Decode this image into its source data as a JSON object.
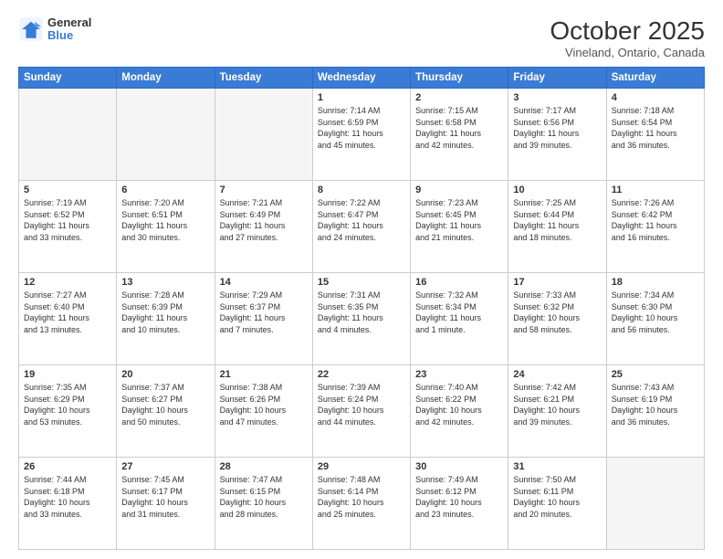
{
  "logo": {
    "general": "General",
    "blue": "Blue"
  },
  "title": "October 2025",
  "location": "Vineland, Ontario, Canada",
  "days_header": [
    "Sunday",
    "Monday",
    "Tuesday",
    "Wednesday",
    "Thursday",
    "Friday",
    "Saturday"
  ],
  "weeks": [
    [
      {
        "day": "",
        "info": ""
      },
      {
        "day": "",
        "info": ""
      },
      {
        "day": "",
        "info": ""
      },
      {
        "day": "1",
        "info": "Sunrise: 7:14 AM\nSunset: 6:59 PM\nDaylight: 11 hours\nand 45 minutes."
      },
      {
        "day": "2",
        "info": "Sunrise: 7:15 AM\nSunset: 6:58 PM\nDaylight: 11 hours\nand 42 minutes."
      },
      {
        "day": "3",
        "info": "Sunrise: 7:17 AM\nSunset: 6:56 PM\nDaylight: 11 hours\nand 39 minutes."
      },
      {
        "day": "4",
        "info": "Sunrise: 7:18 AM\nSunset: 6:54 PM\nDaylight: 11 hours\nand 36 minutes."
      }
    ],
    [
      {
        "day": "5",
        "info": "Sunrise: 7:19 AM\nSunset: 6:52 PM\nDaylight: 11 hours\nand 33 minutes."
      },
      {
        "day": "6",
        "info": "Sunrise: 7:20 AM\nSunset: 6:51 PM\nDaylight: 11 hours\nand 30 minutes."
      },
      {
        "day": "7",
        "info": "Sunrise: 7:21 AM\nSunset: 6:49 PM\nDaylight: 11 hours\nand 27 minutes."
      },
      {
        "day": "8",
        "info": "Sunrise: 7:22 AM\nSunset: 6:47 PM\nDaylight: 11 hours\nand 24 minutes."
      },
      {
        "day": "9",
        "info": "Sunrise: 7:23 AM\nSunset: 6:45 PM\nDaylight: 11 hours\nand 21 minutes."
      },
      {
        "day": "10",
        "info": "Sunrise: 7:25 AM\nSunset: 6:44 PM\nDaylight: 11 hours\nand 18 minutes."
      },
      {
        "day": "11",
        "info": "Sunrise: 7:26 AM\nSunset: 6:42 PM\nDaylight: 11 hours\nand 16 minutes."
      }
    ],
    [
      {
        "day": "12",
        "info": "Sunrise: 7:27 AM\nSunset: 6:40 PM\nDaylight: 11 hours\nand 13 minutes."
      },
      {
        "day": "13",
        "info": "Sunrise: 7:28 AM\nSunset: 6:39 PM\nDaylight: 11 hours\nand 10 minutes."
      },
      {
        "day": "14",
        "info": "Sunrise: 7:29 AM\nSunset: 6:37 PM\nDaylight: 11 hours\nand 7 minutes."
      },
      {
        "day": "15",
        "info": "Sunrise: 7:31 AM\nSunset: 6:35 PM\nDaylight: 11 hours\nand 4 minutes."
      },
      {
        "day": "16",
        "info": "Sunrise: 7:32 AM\nSunset: 6:34 PM\nDaylight: 11 hours\nand 1 minute."
      },
      {
        "day": "17",
        "info": "Sunrise: 7:33 AM\nSunset: 6:32 PM\nDaylight: 10 hours\nand 58 minutes."
      },
      {
        "day": "18",
        "info": "Sunrise: 7:34 AM\nSunset: 6:30 PM\nDaylight: 10 hours\nand 56 minutes."
      }
    ],
    [
      {
        "day": "19",
        "info": "Sunrise: 7:35 AM\nSunset: 6:29 PM\nDaylight: 10 hours\nand 53 minutes."
      },
      {
        "day": "20",
        "info": "Sunrise: 7:37 AM\nSunset: 6:27 PM\nDaylight: 10 hours\nand 50 minutes."
      },
      {
        "day": "21",
        "info": "Sunrise: 7:38 AM\nSunset: 6:26 PM\nDaylight: 10 hours\nand 47 minutes."
      },
      {
        "day": "22",
        "info": "Sunrise: 7:39 AM\nSunset: 6:24 PM\nDaylight: 10 hours\nand 44 minutes."
      },
      {
        "day": "23",
        "info": "Sunrise: 7:40 AM\nSunset: 6:22 PM\nDaylight: 10 hours\nand 42 minutes."
      },
      {
        "day": "24",
        "info": "Sunrise: 7:42 AM\nSunset: 6:21 PM\nDaylight: 10 hours\nand 39 minutes."
      },
      {
        "day": "25",
        "info": "Sunrise: 7:43 AM\nSunset: 6:19 PM\nDaylight: 10 hours\nand 36 minutes."
      }
    ],
    [
      {
        "day": "26",
        "info": "Sunrise: 7:44 AM\nSunset: 6:18 PM\nDaylight: 10 hours\nand 33 minutes."
      },
      {
        "day": "27",
        "info": "Sunrise: 7:45 AM\nSunset: 6:17 PM\nDaylight: 10 hours\nand 31 minutes."
      },
      {
        "day": "28",
        "info": "Sunrise: 7:47 AM\nSunset: 6:15 PM\nDaylight: 10 hours\nand 28 minutes."
      },
      {
        "day": "29",
        "info": "Sunrise: 7:48 AM\nSunset: 6:14 PM\nDaylight: 10 hours\nand 25 minutes."
      },
      {
        "day": "30",
        "info": "Sunrise: 7:49 AM\nSunset: 6:12 PM\nDaylight: 10 hours\nand 23 minutes."
      },
      {
        "day": "31",
        "info": "Sunrise: 7:50 AM\nSunset: 6:11 PM\nDaylight: 10 hours\nand 20 minutes."
      },
      {
        "day": "",
        "info": ""
      }
    ]
  ]
}
